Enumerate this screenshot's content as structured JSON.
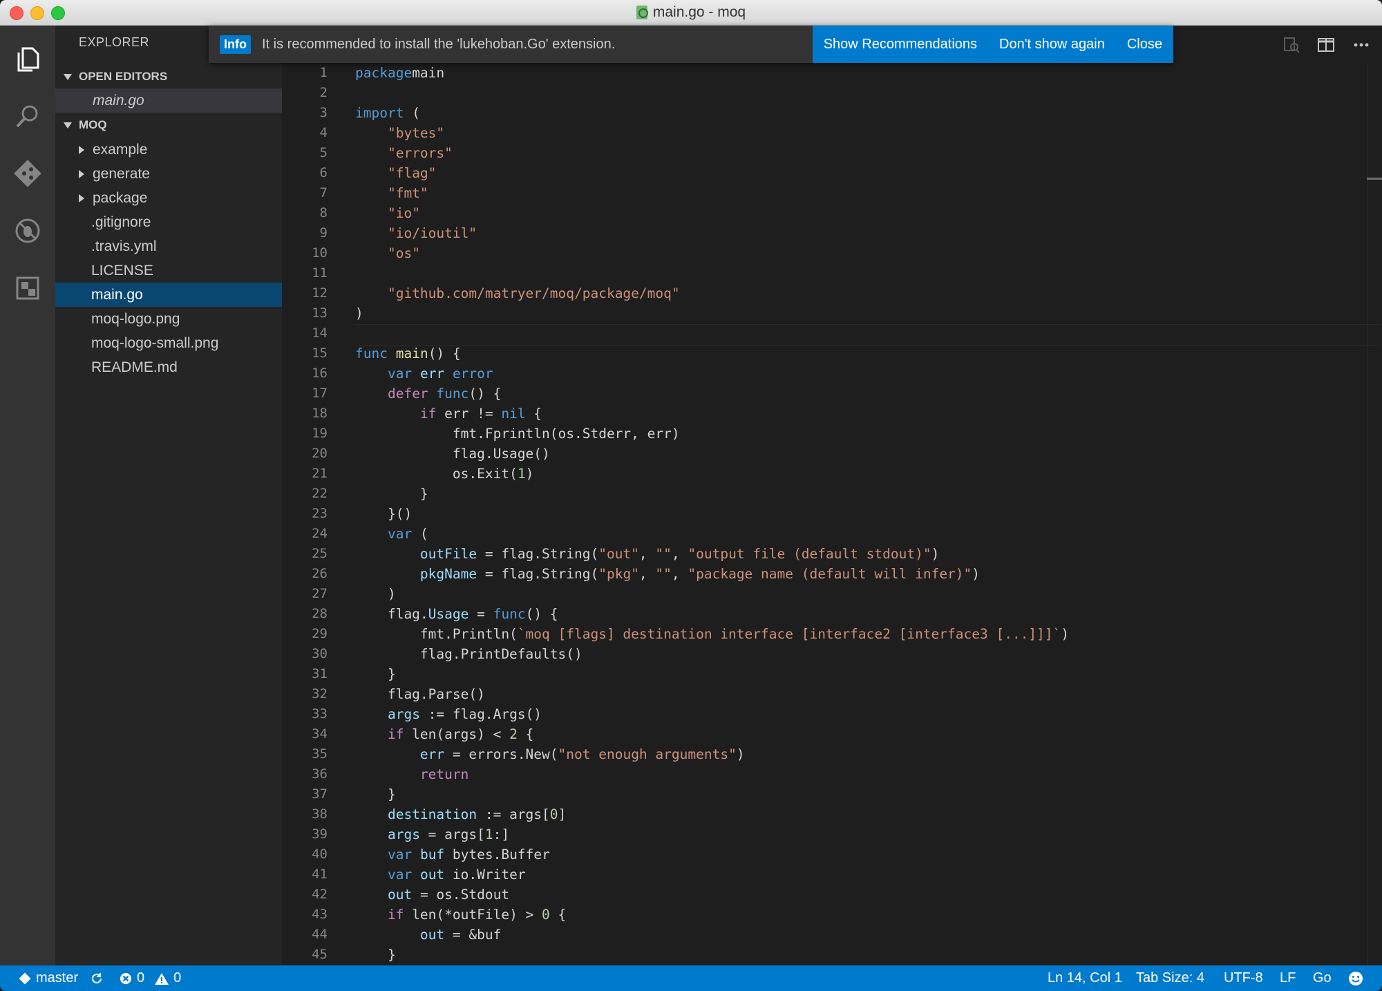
{
  "window": {
    "title": "main.go - moq"
  },
  "sidebar": {
    "title": "EXPLORER",
    "open_editors_label": "OPEN EDITORS",
    "open_editors": [
      {
        "label": "main.go"
      }
    ],
    "project_label": "MOQ",
    "folders": [
      {
        "label": "example"
      },
      {
        "label": "generate"
      },
      {
        "label": "package"
      }
    ],
    "files": [
      {
        "label": ".gitignore"
      },
      {
        "label": ".travis.yml"
      },
      {
        "label": "LICENSE"
      },
      {
        "label": "main.go"
      },
      {
        "label": "moq-logo.png"
      },
      {
        "label": "moq-logo-small.png"
      },
      {
        "label": "README.md"
      }
    ]
  },
  "notification": {
    "badge": "Info",
    "message": "It is recommended to install the 'lukehoban.Go' extension.",
    "actions": {
      "show": "Show Recommendations",
      "dont_show": "Don't show again",
      "close": "Close"
    }
  },
  "editor": {
    "line_numbers": [
      "1",
      "2",
      "3",
      "4",
      "5",
      "6",
      "7",
      "8",
      "9",
      "10",
      "11",
      "12",
      "13",
      "14",
      "15",
      "16",
      "17",
      "18",
      "19",
      "20",
      "21",
      "22",
      "23",
      "24",
      "25",
      "26",
      "27",
      "28",
      "29",
      "30",
      "31",
      "32",
      "33",
      "34",
      "35",
      "36",
      "37",
      "38",
      "39",
      "40",
      "41",
      "42",
      "43",
      "44",
      "45"
    ],
    "lines": [
      [
        [
          "kw",
          "package"
        ],
        [
          "",
          "main"
        ]
      ],
      [],
      [
        [
          "kw",
          "import"
        ],
        [
          "",
          " ("
        ]
      ],
      [
        [
          "",
          "    "
        ],
        [
          "str",
          "\"bytes\""
        ]
      ],
      [
        [
          "",
          "    "
        ],
        [
          "str",
          "\"errors\""
        ]
      ],
      [
        [
          "",
          "    "
        ],
        [
          "str",
          "\"flag\""
        ]
      ],
      [
        [
          "",
          "    "
        ],
        [
          "str",
          "\"fmt\""
        ]
      ],
      [
        [
          "",
          "    "
        ],
        [
          "str",
          "\"io\""
        ]
      ],
      [
        [
          "",
          "    "
        ],
        [
          "str",
          "\"io/ioutil\""
        ]
      ],
      [
        [
          "",
          "    "
        ],
        [
          "str",
          "\"os\""
        ]
      ],
      [],
      [
        [
          "",
          "    "
        ],
        [
          "str",
          "\"github.com/matryer/moq/package/moq\""
        ]
      ],
      [
        [
          "",
          ")"
        ]
      ],
      [],
      [
        [
          "kw",
          "func"
        ],
        [
          "",
          " "
        ],
        [
          "fn",
          "main"
        ],
        [
          "",
          "() {"
        ]
      ],
      [
        [
          "",
          "    "
        ],
        [
          "kw",
          "var"
        ],
        [
          "",
          " "
        ],
        [
          "id",
          "err"
        ],
        [
          "",
          " "
        ],
        [
          "kw",
          "error"
        ]
      ],
      [
        [
          "",
          "    "
        ],
        [
          "kw2",
          "defer"
        ],
        [
          "",
          " "
        ],
        [
          "kw",
          "func"
        ],
        [
          "",
          "() {"
        ]
      ],
      [
        [
          "",
          "        "
        ],
        [
          "kw2",
          "if"
        ],
        [
          "",
          " err != "
        ],
        [
          "kw",
          "nil"
        ],
        [
          "",
          " {"
        ]
      ],
      [
        [
          "",
          "            fmt.Fprintln(os.Stderr, err)"
        ]
      ],
      [
        [
          "",
          "            flag.Usage()"
        ]
      ],
      [
        [
          "",
          "            os.Exit("
        ],
        [
          "num",
          "1"
        ],
        [
          "",
          ")"
        ]
      ],
      [
        [
          "",
          "        }"
        ]
      ],
      [
        [
          "",
          "    }()"
        ]
      ],
      [
        [
          "",
          "    "
        ],
        [
          "kw",
          "var"
        ],
        [
          "",
          " ("
        ]
      ],
      [
        [
          "",
          "        "
        ],
        [
          "id",
          "outFile"
        ],
        [
          "",
          " = flag.String("
        ],
        [
          "str",
          "\"out\""
        ],
        [
          "",
          ", "
        ],
        [
          "str",
          "\"\""
        ],
        [
          "",
          ", "
        ],
        [
          "str",
          "\"output file (default stdout)\""
        ],
        [
          "",
          ")"
        ]
      ],
      [
        [
          "",
          "        "
        ],
        [
          "id",
          "pkgName"
        ],
        [
          "",
          " = flag.String("
        ],
        [
          "str",
          "\"pkg\""
        ],
        [
          "",
          ", "
        ],
        [
          "str",
          "\"\""
        ],
        [
          "",
          ", "
        ],
        [
          "str",
          "\"package name (default will infer)\""
        ],
        [
          "",
          ")"
        ]
      ],
      [
        [
          "",
          "    )"
        ]
      ],
      [
        [
          "",
          "    flag."
        ],
        [
          "id",
          "Usage"
        ],
        [
          "",
          " = "
        ],
        [
          "kw",
          "func"
        ],
        [
          "",
          "() {"
        ]
      ],
      [
        [
          "",
          "        fmt.Println("
        ],
        [
          "str",
          "`moq [flags] destination interface [interface2 [interface3 [...]]]`"
        ],
        [
          "",
          ")"
        ]
      ],
      [
        [
          "",
          "        flag.PrintDefaults()"
        ]
      ],
      [
        [
          "",
          "    }"
        ]
      ],
      [
        [
          "",
          "    flag.Parse()"
        ]
      ],
      [
        [
          "",
          "    "
        ],
        [
          "id",
          "args"
        ],
        [
          "",
          " := flag.Args()"
        ]
      ],
      [
        [
          "",
          "    "
        ],
        [
          "kw2",
          "if"
        ],
        [
          "",
          " len(args) < "
        ],
        [
          "num",
          "2"
        ],
        [
          "",
          " {"
        ]
      ],
      [
        [
          "",
          "        "
        ],
        [
          "id",
          "err"
        ],
        [
          "",
          " = errors.New("
        ],
        [
          "str",
          "\"not enough arguments\""
        ],
        [
          "",
          ")"
        ]
      ],
      [
        [
          "",
          "        "
        ],
        [
          "kw2",
          "return"
        ]
      ],
      [
        [
          "",
          "    }"
        ]
      ],
      [
        [
          "",
          "    "
        ],
        [
          "id",
          "destination"
        ],
        [
          "",
          " := args["
        ],
        [
          "num",
          "0"
        ],
        [
          "",
          "]"
        ]
      ],
      [
        [
          "",
          "    "
        ],
        [
          "id",
          "args"
        ],
        [
          "",
          " = args["
        ],
        [
          "num",
          "1"
        ],
        [
          "",
          ":]"
        ]
      ],
      [
        [
          "",
          "    "
        ],
        [
          "kw",
          "var"
        ],
        [
          "",
          " "
        ],
        [
          "id",
          "buf"
        ],
        [
          "",
          " bytes.Buffer"
        ]
      ],
      [
        [
          "",
          "    "
        ],
        [
          "kw",
          "var"
        ],
        [
          "",
          " "
        ],
        [
          "id",
          "out"
        ],
        [
          "",
          " io.Writer"
        ]
      ],
      [
        [
          "",
          "    "
        ],
        [
          "id",
          "out"
        ],
        [
          "",
          " = os.Stdout"
        ]
      ],
      [
        [
          "",
          "    "
        ],
        [
          "kw2",
          "if"
        ],
        [
          "",
          " len(*outFile) > "
        ],
        [
          "num",
          "0"
        ],
        [
          "",
          " {"
        ]
      ],
      [
        [
          "",
          "        "
        ],
        [
          "id",
          "out"
        ],
        [
          "",
          " = &buf"
        ]
      ],
      [
        [
          "",
          "    }"
        ]
      ]
    ]
  },
  "statusbar": {
    "branch": "master",
    "errors": "0",
    "warnings": "0",
    "position": "Ln 14, Col 1",
    "tab_size": "Tab Size: 4",
    "encoding": "UTF-8",
    "eol": "LF",
    "language": "Go"
  },
  "icons": {
    "activity": [
      "files-icon",
      "search-icon",
      "git-icon",
      "debug-icon",
      "extensions-icon"
    ],
    "toolbar": [
      "open-changes-icon",
      "split-editor-icon",
      "more-icon"
    ],
    "status": [
      "git-branch-icon",
      "sync-icon",
      "error-icon",
      "warning-icon",
      "feedback-smiley-icon"
    ]
  },
  "colors": {
    "accent": "#007acc",
    "selection": "#094771",
    "keyword": "#569cd6",
    "string": "#ce9178"
  }
}
